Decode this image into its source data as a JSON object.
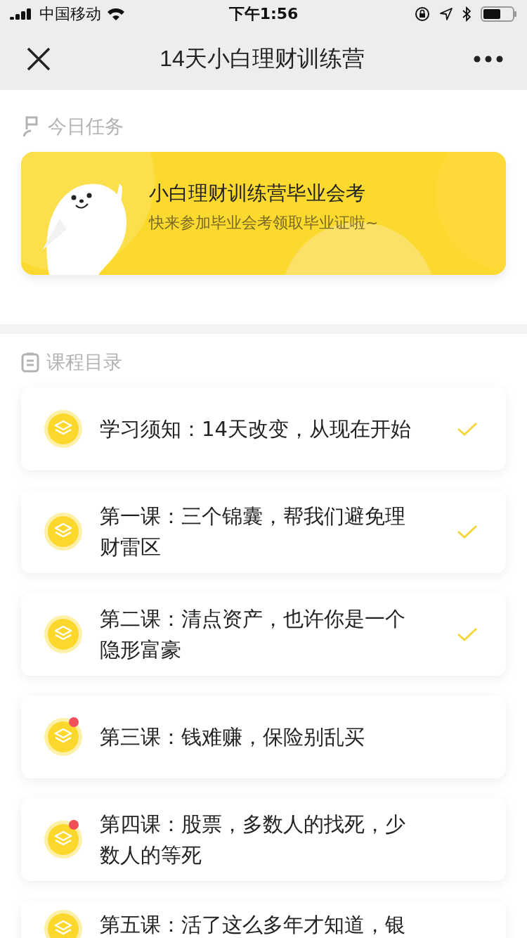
{
  "status_bar": {
    "carrier": "中国移动",
    "time": "下午1:56"
  },
  "nav": {
    "title": "14天小白理财训练营"
  },
  "today": {
    "heading": "今日任务",
    "banner": {
      "title": "小白理财训练营毕业会考",
      "subtitle": "快来参加毕业会考领取毕业证啦~"
    }
  },
  "catalog": {
    "heading": "课程目录",
    "lessons": [
      {
        "title": "学习须知：14天改变，从现在开始",
        "completed": true,
        "unread": false
      },
      {
        "title": "第一课：三个锦囊，帮我们避免理财雷区",
        "completed": true,
        "unread": false
      },
      {
        "title": "第二课：清点资产，也许你是一个隐形富豪",
        "completed": true,
        "unread": false
      },
      {
        "title": "第三课：钱难赚，保险别乱买",
        "completed": false,
        "unread": true
      },
      {
        "title": "第四课：股票，多数人的找死，少数人的等死",
        "completed": false,
        "unread": true
      },
      {
        "title": "第五课：活了这么多年才知道，银",
        "completed": false,
        "unread": false
      }
    ]
  }
}
